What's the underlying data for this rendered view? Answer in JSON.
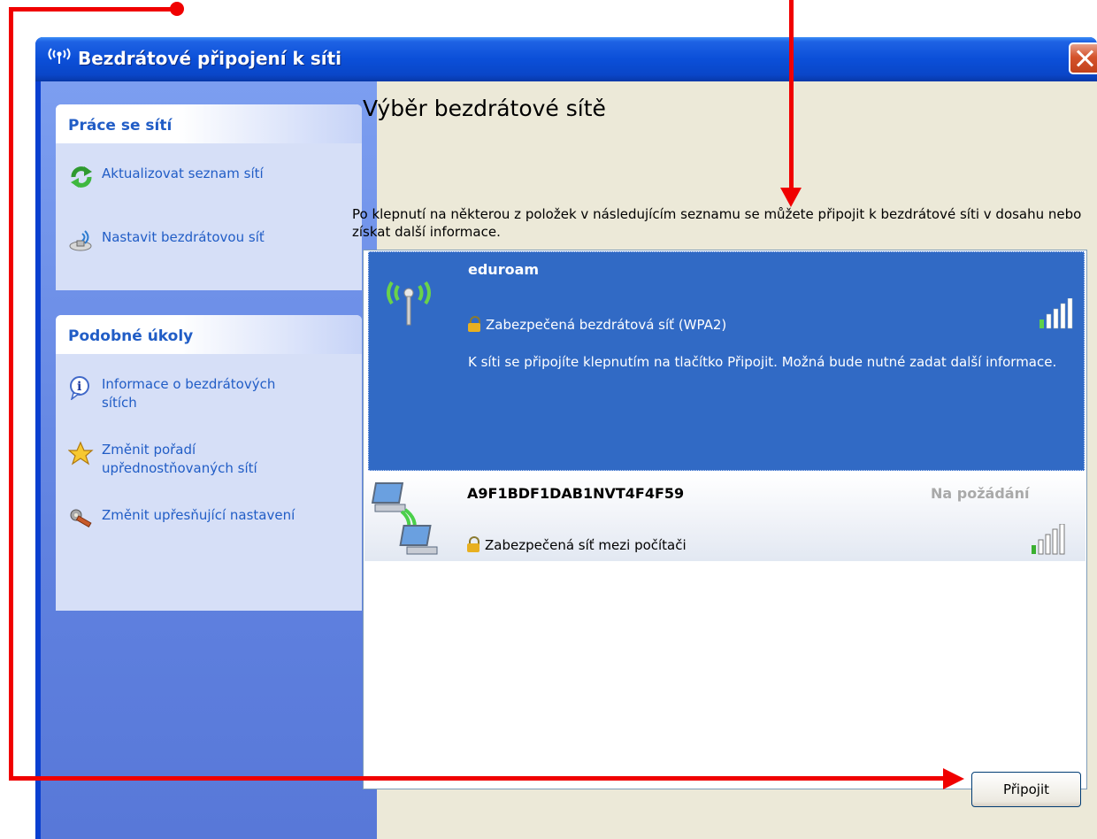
{
  "window": {
    "title": "Bezdrátové připojení k síti"
  },
  "taskpane": {
    "network_tasks": {
      "header": "Práce se sítí",
      "items": [
        {
          "label": "Aktualizovat seznam sítí",
          "icon": "refresh-icon"
        },
        {
          "label": "Nastavit bezdrátovou síť",
          "icon": "wireless-setup-icon"
        }
      ]
    },
    "related_tasks": {
      "header": "Podobné úkoly",
      "items": [
        {
          "label": "Informace o bezdrátových sítích",
          "icon": "info-icon"
        },
        {
          "label": "Změnit pořadí upřednostňovaných sítí",
          "icon": "star-icon"
        },
        {
          "label": "Změnit upřesňující nastavení",
          "icon": "tools-icon"
        }
      ]
    }
  },
  "main": {
    "title": "Výběr bezdrátové sítě",
    "description": "Po klepnutí na některou z položek v následujícím seznamu se můžete připojit k bezdrátové síti v dosahu nebo získat další informace.",
    "networks": [
      {
        "ssid": "eduroam",
        "security": "Zabezpečená bezdrátová síť (WPA2)",
        "detail": "K síti se připojíte klepnutím na tlačítko Připojit. Možná bude nutné zadat další informace.",
        "signal_bars": 5,
        "selected": true
      },
      {
        "ssid": "A9F1BDF1DAB1NVT4F4F59",
        "status": "Na požádání",
        "security": "Zabezpečená síť mezi počítači",
        "signal_bars": 1,
        "selected": false
      }
    ],
    "connect_label": "Připojit"
  },
  "colors": {
    "titlebar": "#0a4fd8",
    "selection": "#316ac5",
    "link_blue": "#215dc6",
    "annotation": "#f00000"
  }
}
